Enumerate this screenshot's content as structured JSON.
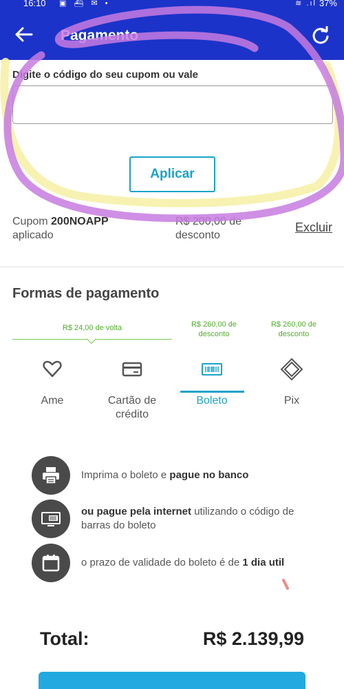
{
  "status_bar": {
    "time": "16:10",
    "battery": "37%"
  },
  "app_bar": {
    "title": "Pagamento"
  },
  "coupon": {
    "label": "Digite o código do seu cupom ou vale",
    "input_value": "",
    "apply_label": "Aplicar",
    "applied_prefix": "Cupom ",
    "applied_code": "200NOAPP",
    "applied_suffix": "aplicado",
    "discount_line1": "R$ 200,00 de",
    "discount_line2": "desconto",
    "remove_label": "Excluir"
  },
  "payment": {
    "section_title": "Formas de pagamento",
    "promos": {
      "ame": "R$ 24,00 de volta",
      "boleto_line1": "R$ 260,00 de",
      "boleto_line2": "desconto",
      "pix_line1": "R$ 260,00 de",
      "pix_line2": "desconto"
    },
    "tabs": {
      "ame": "Ame",
      "card_line1": "Cartão de",
      "card_line2": "crédito",
      "boleto": "Boleto",
      "pix": "Pix"
    },
    "selected_tab": "Boleto"
  },
  "boleto_info": {
    "row1_a": "Imprima o boleto e ",
    "row1_b": "pague no banco",
    "row2_a": "ou pague pela internet",
    "row2_b": " utilizando o código de barras do boleto",
    "row3_a": "o prazo de validade do boleto é de ",
    "row3_b": "1 dia util"
  },
  "total": {
    "label": "Total:",
    "value": "R$ 2.139,99"
  },
  "colors": {
    "app_bar": "#1c33c9",
    "accent": "#1aa3c8",
    "promo_green": "#4fae2a",
    "highlight_yellow": "#f6f1a8",
    "highlight_purple": "#c77be0"
  }
}
